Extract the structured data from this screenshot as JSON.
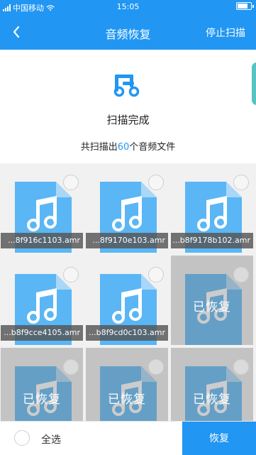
{
  "status_bar": {
    "carrier": "中国移动",
    "time": "15:05"
  },
  "header": {
    "title": "音频恢复",
    "stop_scan_label": "停止扫描"
  },
  "summary": {
    "status": "扫描完成",
    "count_prefix": "共扫描出",
    "count": "60",
    "count_suffix": "个音频文件",
    "icon": "audio-file-icon"
  },
  "files": [
    {
      "name": "...8f916c1103.amr",
      "recovered": false
    },
    {
      "name": "...8f9170e103.amr",
      "recovered": false
    },
    {
      "name": "...b8f9178b102.amr",
      "recovered": false
    },
    {
      "name": "...b8f9cce4105.amr",
      "recovered": false
    },
    {
      "name": "...b8f9cd0c103.amr",
      "recovered": false
    },
    {
      "name": "",
      "recovered": true
    },
    {
      "name": "",
      "recovered": true
    },
    {
      "name": "",
      "recovered": true
    },
    {
      "name": "",
      "recovered": true
    }
  ],
  "recovered_label": "已恢复",
  "bottom": {
    "select_all_label": "全选",
    "recover_label": "恢复"
  },
  "colors": {
    "primary": "#2196f3",
    "doc_blue": "#5ab6f5",
    "doc_fold": "#a9d7f8"
  }
}
